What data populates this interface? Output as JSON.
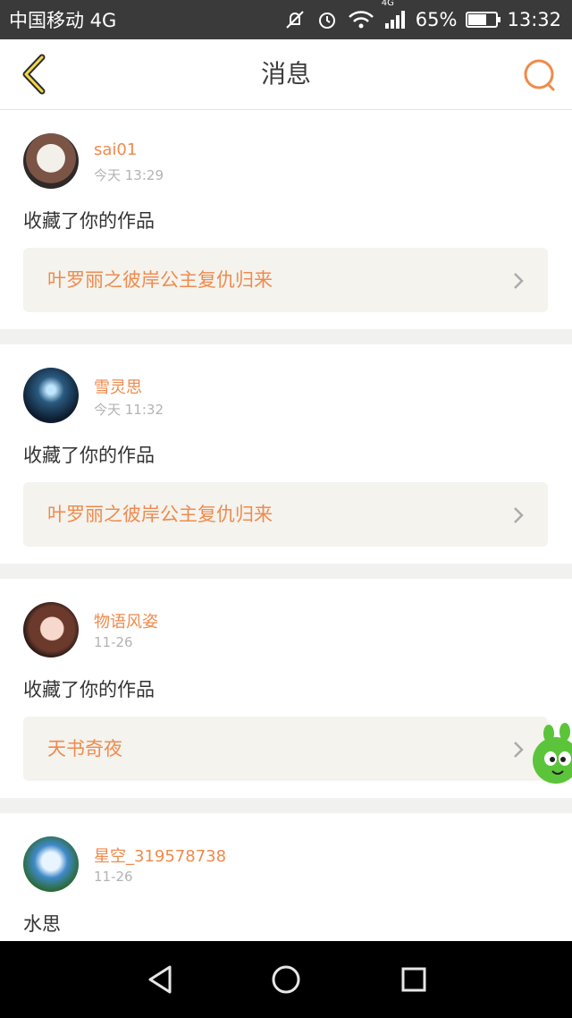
{
  "status_bar": {
    "carrier": "中国移动 4G",
    "network_label": "4G",
    "battery_percent": "65%",
    "battery_level": 0.65,
    "time": "13:32",
    "icons": [
      "mute-icon",
      "alarm-icon",
      "wifi-icon",
      "signal-icon",
      "battery-icon"
    ]
  },
  "header": {
    "title": "消息",
    "back_icon": "chevron-left-icon",
    "search_icon": "search-icon"
  },
  "messages": [
    {
      "username": "sai01",
      "time": "今天 13:29",
      "action": "收藏了你的作品",
      "work_title": "叶罗丽之彼岸公主复仇归来"
    },
    {
      "username": "雪灵思",
      "time": "今天 11:32",
      "action": "收藏了你的作品",
      "work_title": "叶罗丽之彼岸公主复仇归来"
    },
    {
      "username": "物语风姿",
      "time": "11-26",
      "action": "收藏了你的作品",
      "work_title": "天书奇夜"
    },
    {
      "username": "星空_319578738",
      "time": "11-26",
      "action": "水思",
      "work_title": ""
    }
  ],
  "nav": {
    "back_icon": "nav-back-icon",
    "home_icon": "nav-home-icon",
    "recents_icon": "nav-recents-icon"
  },
  "colors": {
    "accent": "#f08a4b",
    "status_bar": "#3a3a3a",
    "background": "#f1f1ef",
    "link_bg": "#f4f3ee"
  }
}
